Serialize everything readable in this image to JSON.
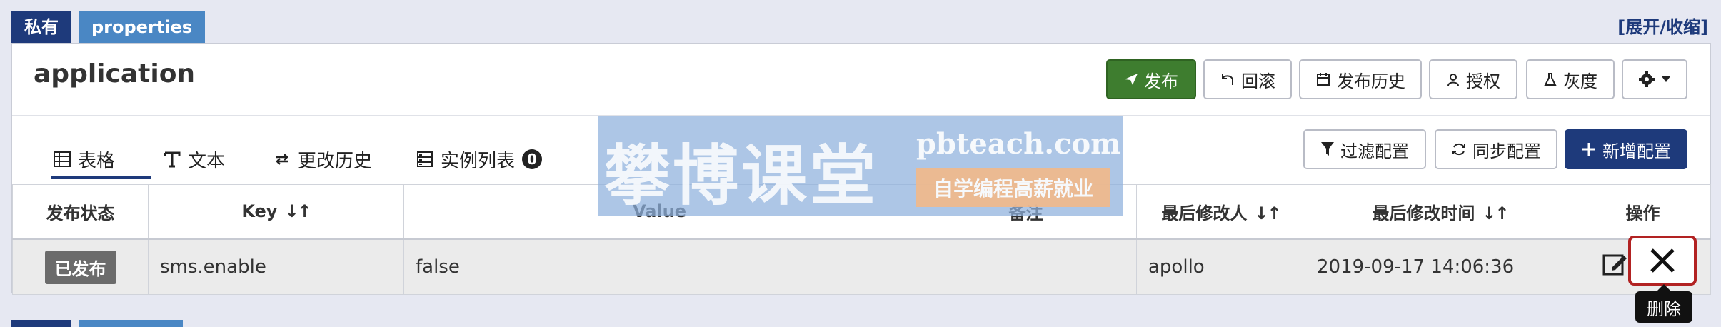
{
  "namespace": {
    "scope_tag": "私有",
    "format_tag": "properties",
    "expand_toggle": "[展开/收缩]",
    "app_name": "application"
  },
  "toolbar": {
    "publish": "发布",
    "rollback": "回滚",
    "publish_history": "发布历史",
    "authorize": "授权",
    "gray": "灰度",
    "settings_icon": "gear-icon"
  },
  "tabs": [
    {
      "label": "表格",
      "icon": "table-icon",
      "active": true
    },
    {
      "label": "文本",
      "icon": "text-icon",
      "active": false
    },
    {
      "label": "更改历史",
      "icon": "history-icon",
      "active": false
    },
    {
      "label": "实例列表",
      "icon": "instances-icon",
      "active": false,
      "count": "0"
    }
  ],
  "actions": {
    "filter": "过滤配置",
    "sync": "同步配置",
    "add": "新增配置"
  },
  "table": {
    "columns": {
      "status": "发布状态",
      "key": "Key",
      "value": "Value",
      "comment": "备注",
      "modifier": "最后修改人",
      "modified_time": "最后修改时间",
      "ops": "操作"
    },
    "sort_glyph": "↓↑",
    "rows": [
      {
        "status": "已发布",
        "key": "sms.enable",
        "value": "false",
        "comment": "",
        "modifier": "apollo",
        "modified_time": "2019-09-17 14:06:36"
      }
    ]
  },
  "tooltip": {
    "delete": "删除"
  },
  "watermark": {
    "name": "攀博课堂",
    "domain": "pbteach.com",
    "slogan": "自学编程高薪就业"
  },
  "colors": {
    "brand_navy": "#1e3a7b",
    "publish_green": "#3e7d2f",
    "tag_blue": "#4a87c4",
    "delete_highlight": "#b22222"
  }
}
